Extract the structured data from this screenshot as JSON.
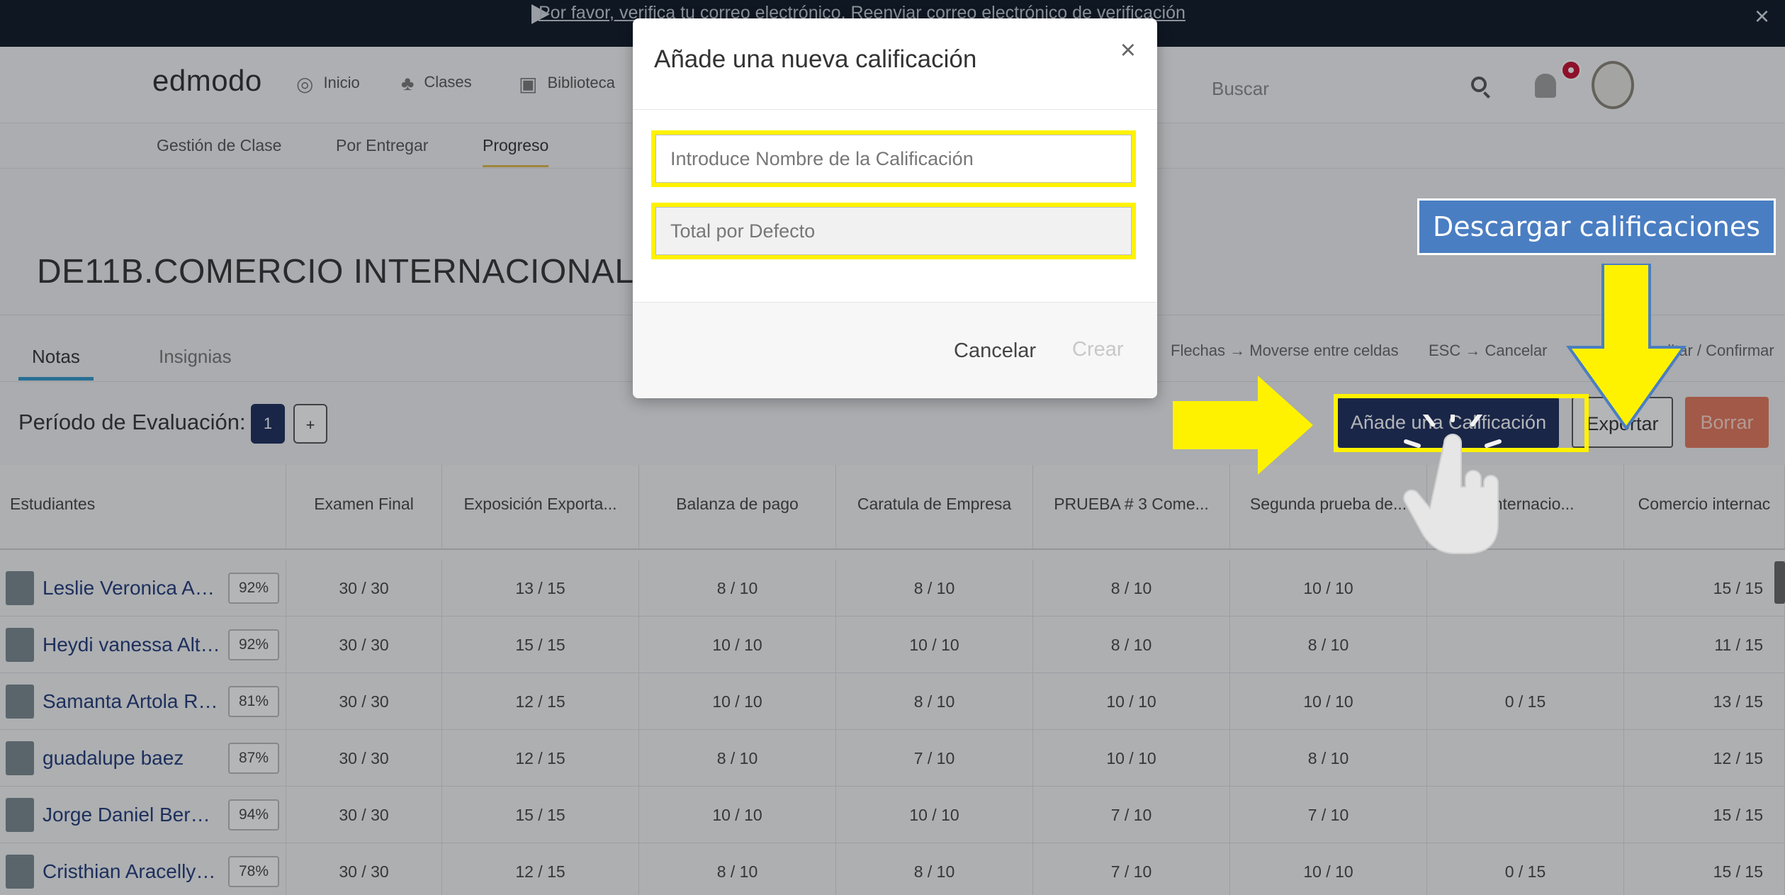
{
  "banner": {
    "message": "Por favor, verifica tu correo electrónico.  Reenviar correo electrónico de verificación",
    "close": "×"
  },
  "nav": {
    "logo": "edmodo",
    "items": [
      "Inicio",
      "Clases",
      "Biblioteca"
    ],
    "search_placeholder": "Buscar"
  },
  "subnav": {
    "items": [
      "Gestión de Clase",
      "Por Entregar",
      "Progreso"
    ]
  },
  "page": {
    "title": "DE11B.COMERCIO INTERNACIONAL-IIC",
    "tabs": [
      "Notas",
      "Insignias"
    ],
    "period_label": "Período de Evaluación:",
    "period_current": "1",
    "period_add": "+"
  },
  "shortcuts": {
    "arrows": "Flechas → Moverse entre celdas",
    "esc": "ESC → Cancelar",
    "enter": "ditar / Confirmar"
  },
  "actions": {
    "add_grade": "Añade una Calificación",
    "export": "Exportar",
    "delete": "Borrar"
  },
  "table": {
    "columns": [
      "Estudiantes",
      "Examen Final",
      "Exposición Exporta...",
      "Balanza de pago",
      "Caratula de Empresa",
      "PRUEBA # 3 Come...",
      "Segunda prueba de...",
      "o internacio...",
      "Comercio internac"
    ],
    "rows": [
      {
        "name": "Leslie Veronica Agu...",
        "pct": "92%",
        "grades": [
          "30 / 30",
          "13 / 15",
          "8 / 10",
          "8 / 10",
          "8 / 10",
          "10 / 10",
          "",
          "15 / 15"
        ]
      },
      {
        "name": "Heydi vanessa Alta...",
        "pct": "92%",
        "grades": [
          "30 / 30",
          "15 / 15",
          "10 / 10",
          "10 / 10",
          "8 / 10",
          "8 / 10",
          "",
          "11 / 15"
        ]
      },
      {
        "name": "Samanta Artola Ray...",
        "pct": "81%",
        "grades": [
          "30 / 30",
          "12 / 15",
          "10 / 10",
          "8 / 10",
          "10 / 10",
          "10 / 10",
          "0 / 15",
          "13 / 15"
        ]
      },
      {
        "name": "guadalupe baez",
        "pct": "87%",
        "grades": [
          "30 / 30",
          "12 / 15",
          "8 / 10",
          "7 / 10",
          "10 / 10",
          "8 / 10",
          "",
          "12 / 15"
        ]
      },
      {
        "name": "Jorge Daniel Bermu...",
        "pct": "94%",
        "grades": [
          "30 / 30",
          "15 / 15",
          "10 / 10",
          "10 / 10",
          "7 / 10",
          "7 / 10",
          "",
          "15 / 15"
        ]
      },
      {
        "name": "Cristhian Aracelly C...",
        "pct": "78%",
        "grades": [
          "30 / 30",
          "12 / 15",
          "8 / 10",
          "8 / 10",
          "7 / 10",
          "10 / 10",
          "0 / 15",
          "15 / 15"
        ]
      }
    ]
  },
  "modal": {
    "title": "Añade una nueva calificación",
    "close": "×",
    "name_placeholder": "Introduce Nombre de la Calificación",
    "total_placeholder": "Total por Defecto",
    "cancel": "Cancelar",
    "create": "Crear"
  },
  "annotation": {
    "label": "Descargar calificaciones",
    "highlight_color": "#fff200",
    "label_color": "#4a7ec2"
  }
}
